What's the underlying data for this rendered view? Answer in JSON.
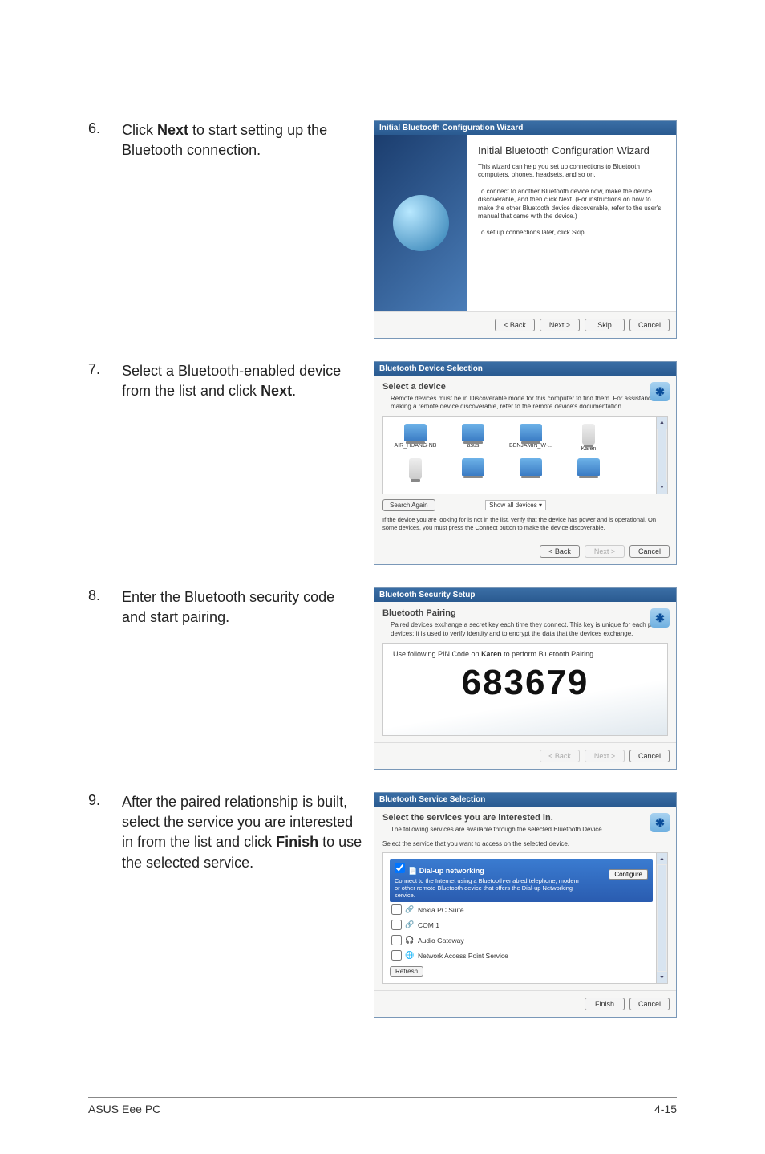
{
  "step6": {
    "num": "6.",
    "text_lead": "Click ",
    "text_bold": "Next",
    "text_tail": " to start setting up the Bluetooth connection.",
    "dialog_title": "Initial Bluetooth Configuration Wizard",
    "wiz_title": "Initial Bluetooth Configuration Wizard",
    "p1": "This wizard can help you set up connections to Bluetooth computers, phones, headsets, and so on.",
    "p2": "To connect to another Bluetooth device now, make the device discoverable, and then click Next. (For instructions on how to make the other Bluetooth device discoverable, refer to the user's manual that came with the device.)",
    "p3": "To set up connections later, click Skip.",
    "btn_back": "< Back",
    "btn_next": "Next >",
    "btn_skip": "Skip",
    "btn_cancel": "Cancel"
  },
  "step7": {
    "num": "7.",
    "text_lead": "Select a Bluetooth-enabled device from the list and click ",
    "text_bold": "Next",
    "text_tail": ".",
    "dialog_title": "Bluetooth Device Selection",
    "heading": "Select a device",
    "sub": "Remote devices must be in Discoverable mode for this computer to find them. For assistance in making a remote device discoverable, refer to the remote device's documentation.",
    "devices": [
      "AIR_HUANG-NB",
      "asus",
      "BENJAMIN_W-...",
      "Karen",
      "",
      "",
      "",
      ""
    ],
    "search": "Search Again",
    "showall": "Show all devices",
    "hint": "If the device you are looking for is not in the list, verify that the device has power and is operational. On some devices, you must press the Connect button to make the device discoverable.",
    "btn_back": "< Back",
    "btn_next": "Next >",
    "btn_cancel": "Cancel"
  },
  "step8": {
    "num": "8.",
    "text": "Enter the Bluetooth security code and start pairing.",
    "dialog_title": "Bluetooth Security Setup",
    "heading": "Bluetooth Pairing",
    "sub": "Paired devices exchange a secret key each time they connect. This key is unique for each pair of devices; it is used to verify identity and to encrypt the data that the devices exchange.",
    "instr_lead": "Use following PIN Code on ",
    "instr_name": "Karen",
    "instr_tail": " to perform Bluetooth Pairing.",
    "pin": "683679",
    "btn_back": "< Back",
    "btn_next": "Next >",
    "btn_cancel": "Cancel"
  },
  "step9": {
    "num": "9.",
    "text_lead": "After the paired relationship is built, select the service you are interested in from the list and click ",
    "text_bold": "Finish",
    "text_tail": " to use the selected service.",
    "dialog_title": "Bluetooth Service Selection",
    "heading": "Select the services you are interested in.",
    "sub": "The following services are available through the selected Bluetooth Device.",
    "instr": "Select the service that you want to access on the selected device.",
    "sel_title": "Dial-up networking",
    "sel_desc": "Connect to the Internet using a Bluetooth-enabled telephone, modem or other remote Bluetooth device that offers the Dial-up Networking service.",
    "cfg": "Configure",
    "services": [
      "Nokia PC Suite",
      "COM 1",
      "Audio Gateway",
      "Network Access Point Service"
    ],
    "refresh": "Refresh",
    "btn_finish": "Finish",
    "btn_cancel": "Cancel"
  },
  "footer": {
    "left": "ASUS Eee PC",
    "right": "4-15"
  }
}
